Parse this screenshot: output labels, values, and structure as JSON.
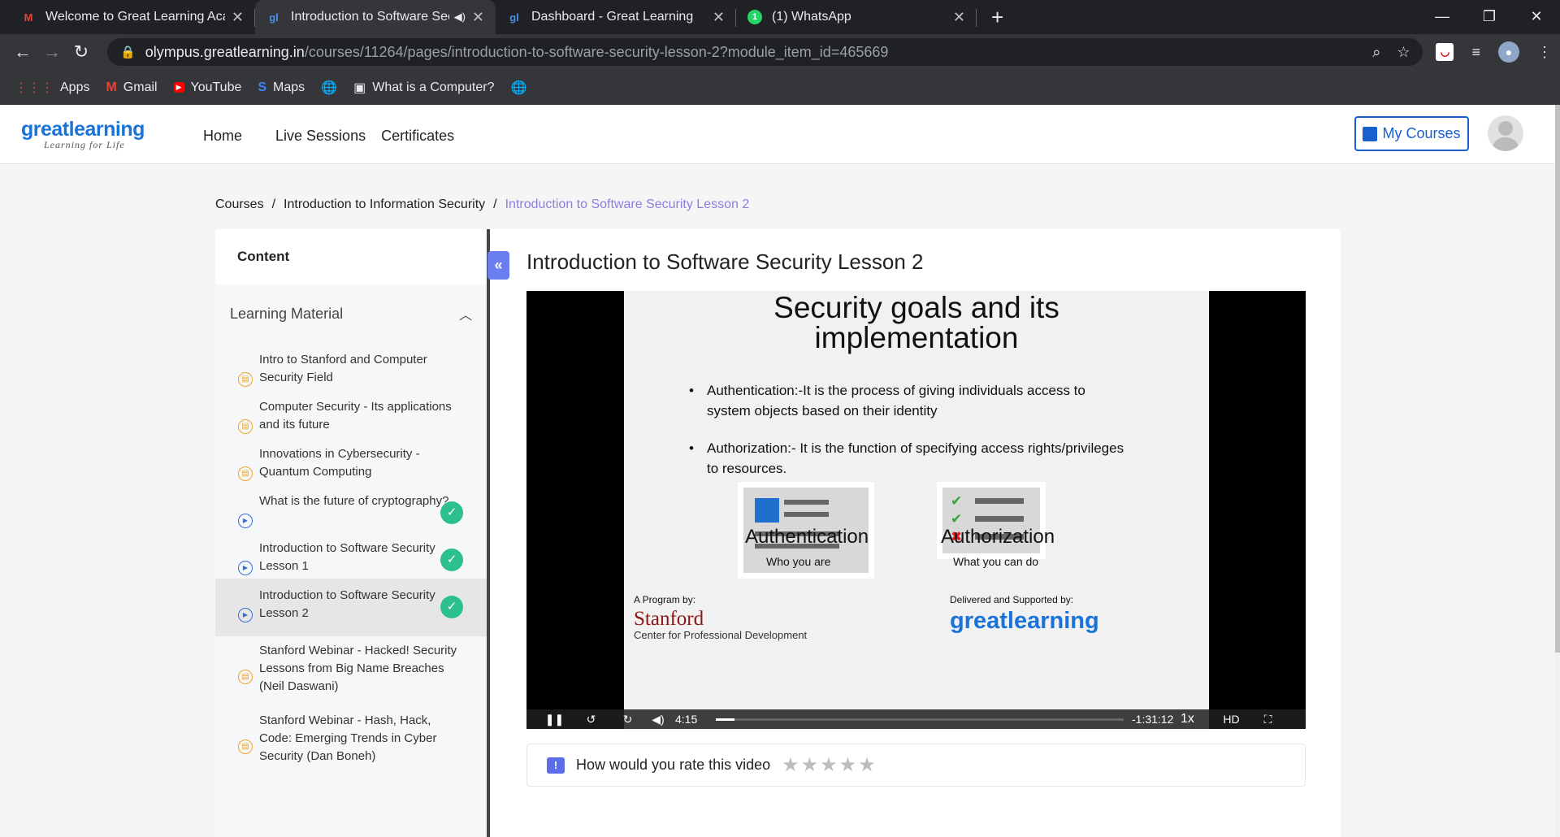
{
  "browser": {
    "tabs": [
      {
        "title": "Welcome to Great Learning Acad",
        "icon": "gmail-icon"
      },
      {
        "title": "Introduction to Software Sec",
        "icon": "greatlearning-icon"
      },
      {
        "title": "Dashboard - Great Learning",
        "icon": "greatlearning-icon"
      },
      {
        "title": "(1) WhatsApp",
        "icon": "whatsapp-icon"
      }
    ],
    "url_host": "olympus.greatlearning.in",
    "url_path": "/courses/11264/pages/introduction-to-software-security-lesson-2?module_item_id=465669",
    "bookmarks": [
      "Apps",
      "Gmail",
      "YouTube",
      "Maps",
      "What is a Computer?"
    ]
  },
  "site": {
    "logo": "greatlearning",
    "logo_tagline": "Learning for Life",
    "nav": [
      "Home",
      "Live Sessions",
      "Certificates"
    ],
    "my_courses": "My Courses"
  },
  "breadcrumb": {
    "items": [
      "Courses",
      "Introduction to Information Security"
    ],
    "current": "Introduction to Software Security Lesson 2"
  },
  "sidebar": {
    "title": "Content",
    "group": "Learning Material",
    "items": [
      {
        "label": "Intro to Stanford and Computer Security Field",
        "kind": "doc",
        "done": false
      },
      {
        "label": "Computer Security - Its applications and its future",
        "kind": "doc",
        "done": false
      },
      {
        "label": "Innovations in Cybersecurity - Quantum Computing",
        "kind": "doc",
        "done": false
      },
      {
        "label": "What is the future of cryptography?",
        "kind": "video",
        "done": true
      },
      {
        "label": "Introduction to Software Security Lesson 1",
        "kind": "video",
        "done": true
      },
      {
        "label": "Introduction to Software Security Lesson 2",
        "kind": "video",
        "done": true
      },
      {
        "label": "Stanford Webinar - Hacked! Security Lessons from Big Name Breaches (Neil Daswani)",
        "kind": "doc",
        "done": false
      },
      {
        "label": "Stanford Webinar - Hash, Hack, Code: Emerging Trends in Cyber Security (Dan Boneh)",
        "kind": "doc",
        "done": false
      }
    ]
  },
  "lesson": {
    "title": "Introduction to Software Security Lesson 2"
  },
  "video": {
    "slide_title_1": "Security goals and its",
    "slide_title_2": "implementation",
    "bullets": [
      "Authentication:-It is the process of giving individuals access to system objects based on their identity",
      "Authorization:- It is the function of specifying access rights/privileges to resources."
    ],
    "auth_label": "Authentication",
    "auth_sub": "Who you are",
    "authz_label": "Authorization",
    "authz_sub": "What you can do",
    "program_by": "A Program by:",
    "stanford": "Stanford",
    "stanford_sub": "Center for Professional Development",
    "delivered_by": "Delivered and Supported by:",
    "elapsed": "4:15",
    "remaining": "-1:31:12",
    "speed": "1x",
    "progress": 0.045
  },
  "rating": {
    "prompt": "How would you rate this video",
    "stars": 5,
    "selected": 0
  }
}
